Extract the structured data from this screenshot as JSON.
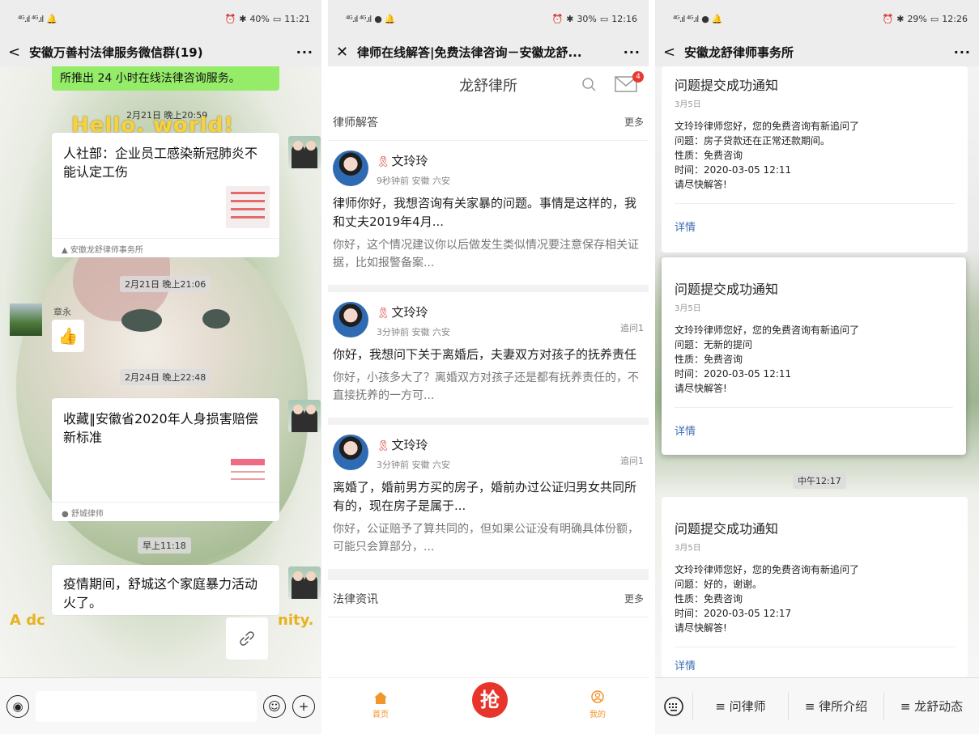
{
  "status": {
    "p1": {
      "net": "⁴ᴳ.ıl ⁴ᴳ.ıl",
      "right": "40%",
      "time": "11:21"
    },
    "p2": {
      "net": "⁴ᴳ.ıl ⁴ᴳ.ıl",
      "right": "30%",
      "time": "12:16"
    },
    "p3": {
      "net": "⁴ᴳ.ıl ⁴ᴳ.ıl",
      "right": "29%",
      "time": "12:26"
    }
  },
  "p1": {
    "title": "安徽万善村法律服务微信群(19)",
    "notice": "所推出 24 小时在线法律咨询服务。",
    "hello": "Hello. world!",
    "ts1": "2月21日 晚上20:59",
    "card1": {
      "title": "人社部：企业员工感染新冠肺炎不能认定工伤",
      "source": "安徽龙舒律师事务所"
    },
    "ts2": "2月21日 晚上21:06",
    "sender": "章永",
    "thumb": "👍",
    "ts3": "2月24日 晚上22:48",
    "card2": {
      "title": "收藏‖安徽省2020年人身损害赔偿新标准",
      "source": "舒城律师"
    },
    "ts4": "早上11:18",
    "card3": {
      "title": "疫情期间，舒城这个家庭暴力活动火了。"
    },
    "side_left": "A dc",
    "side_right": "nity."
  },
  "p2": {
    "title": "律师在线解答|免费法律咨询－安徽龙舒...",
    "brand": "龙舒律所",
    "badge": "4",
    "section1": "律师解答",
    "more": "更多",
    "qa": [
      {
        "name": "文玲玲",
        "meta": "9秒钟前 安徽 六安",
        "follow": "",
        "q": "律师你好，我想咨询有关家暴的问题。事情是这样的，我和丈夫2019年4月...",
        "a": "你好，这个情况建议你以后做发生类似情况要注意保存相关证据，比如报警备案..."
      },
      {
        "name": "文玲玲",
        "meta": "3分钟前 安徽 六安",
        "follow": "追问1",
        "q": "你好，我想问下关于离婚后，夫妻双方对孩子的抚养责任",
        "a": "你好，小孩多大了？离婚双方对孩子还是都有抚养责任的，不直接抚养的一方可..."
      },
      {
        "name": "文玲玲",
        "meta": "3分钟前 安徽 六安",
        "follow": "追问1",
        "q": "离婚了，婚前男方买的房子，婚前办过公证归男女共同所有的，现在房子是属于...",
        "a": "你好，公证赔予了算共同的，但如果公证没有明确具体份额，可能只会算部分，..."
      }
    ],
    "section2": "法律资讯",
    "tabs": {
      "home": "首页",
      "grab": "抢",
      "mine": "我的"
    }
  },
  "p3": {
    "title": "安徽龙舒律师事务所",
    "notices": [
      {
        "title": "问题提交成功通知",
        "date": "3月5日",
        "l1": "文玲玲律师您好，您的免费咨询有新追问了",
        "l2": "问题：房子贷款还在正常还款期间。",
        "l3": "性质：免费咨询",
        "l4": "时间：2020-03-05 12:11",
        "l5": "请尽快解答!",
        "detail": "详情"
      },
      {
        "title": "问题提交成功通知",
        "date": "3月5日",
        "l1": "文玲玲律师您好，您的免费咨询有新追问了",
        "l2": "问题：无新的提问",
        "l3": "性质：免费咨询",
        "l4": "时间：2020-03-05 12:11",
        "l5": "请尽快解答!",
        "detail": "详情"
      },
      {
        "title": "问题提交成功通知",
        "date": "3月5日",
        "l1": "文玲玲律师您好，您的免费咨询有新追问了",
        "l2": "问题：好的，谢谢。",
        "l3": "性质：免费咨询",
        "l4": "时间：2020-03-05 12:17",
        "l5": "请尽快解答!",
        "detail": "详情"
      }
    ],
    "ts": "中午12:17",
    "menu": [
      "≡ 问律师",
      "≡ 律所介绍",
      "≡ 龙舒动态"
    ]
  }
}
